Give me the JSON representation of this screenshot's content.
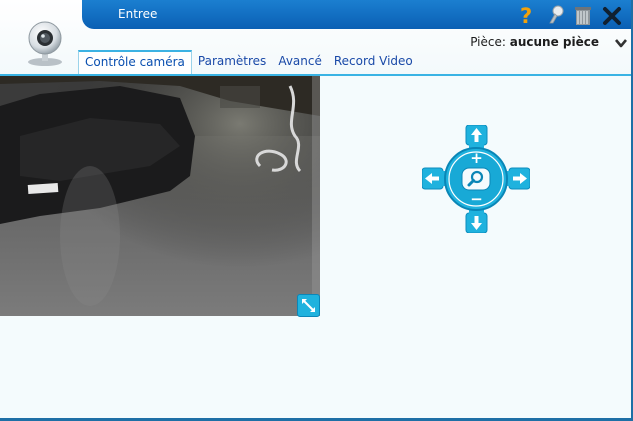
{
  "window": {
    "title": "Entree"
  },
  "room": {
    "label": "Pièce:",
    "value": "aucune pièce"
  },
  "tabs": [
    {
      "label": "Contrôle caméra",
      "active": true
    },
    {
      "label": "Paramètres",
      "active": false
    },
    {
      "label": "Avancé",
      "active": false
    },
    {
      "label": "Record Video",
      "active": false
    }
  ],
  "ptz": {
    "zoom_in": "+",
    "zoom_out": "−"
  },
  "icons": [
    "webcam-icon",
    "help-icon",
    "pin-icon",
    "trash-icon",
    "close-icon",
    "chevron-down-icon",
    "expand-icon",
    "arrow-up-icon",
    "arrow-down-icon",
    "arrow-left-icon",
    "arrow-right-icon",
    "magnifier-icon"
  ],
  "colors": {
    "titlebar": "#0a5fb4",
    "accent": "#1fb2de",
    "tab_text": "#1a4aa8",
    "help": "#f2a20c"
  }
}
